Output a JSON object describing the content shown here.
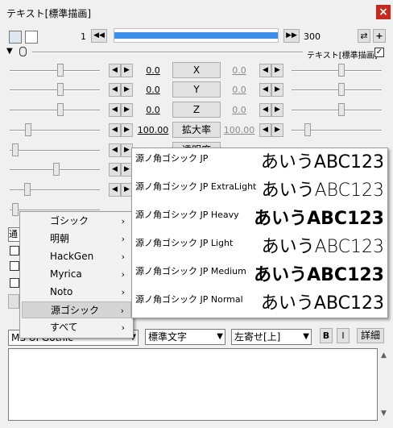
{
  "window": {
    "title": "テキスト[標準描画]",
    "close": "×"
  },
  "toolbar": {
    "frame_start": "1",
    "frame_end": "300",
    "prev": "◀◀",
    "next": "▶▶",
    "swap": "⇄",
    "plus": "+"
  },
  "header": {
    "object_label": "テキスト[標準描画]",
    "toggle": "▼",
    "checked": "✓"
  },
  "params": [
    {
      "label": "X",
      "value": "0.0",
      "value2": "0.0"
    },
    {
      "label": "Y",
      "value": "0.0",
      "value2": "0.0"
    },
    {
      "label": "Z",
      "value": "0.0",
      "value2": "0.0"
    },
    {
      "label": "拡大率",
      "value": "100.00",
      "value2": "100.00"
    },
    {
      "label": "透明度",
      "value": "",
      "value2": ""
    }
  ],
  "context_menu": {
    "items": [
      {
        "label": "ゴシック",
        "chev": "›"
      },
      {
        "label": "明朝",
        "chev": "›"
      },
      {
        "label": "HackGen",
        "chev": "›"
      },
      {
        "label": "Myrica",
        "chev": "›"
      },
      {
        "label": "Noto",
        "chev": "›"
      },
      {
        "label": "源ゴシック",
        "chev": "›"
      },
      {
        "label": "すべて",
        "chev": "›"
      }
    ]
  },
  "font_submenu": {
    "items": [
      {
        "name": "源ノ角ゴシック JP",
        "preview": "あいうABC123",
        "weight": "500"
      },
      {
        "name": "源ノ角ゴシック JP ExtraLight",
        "preview": "あいうABC123",
        "weight": "200"
      },
      {
        "name": "源ノ角ゴシック JP Heavy",
        "preview": "あいうABC123",
        "weight": "900"
      },
      {
        "name": "源ノ角ゴシック JP Light",
        "preview": "あいうABC123",
        "weight": "300"
      },
      {
        "name": "源ノ角ゴシック JP Medium",
        "preview": "あいうABC123",
        "weight": "700"
      },
      {
        "name": "源ノ角ゴシック JP Normal",
        "preview": "あいうABC123",
        "weight": "400"
      }
    ]
  },
  "bottom": {
    "font_combo": "MS UI Gothic",
    "style_combo": "標準文字",
    "align_combo": "左寄せ[上]",
    "bold": "B",
    "italic": "I",
    "detail": "詳細",
    "partial_label": "通"
  },
  "colors": {
    "accent": "#3c8fe8",
    "close": "#c42b1c"
  }
}
